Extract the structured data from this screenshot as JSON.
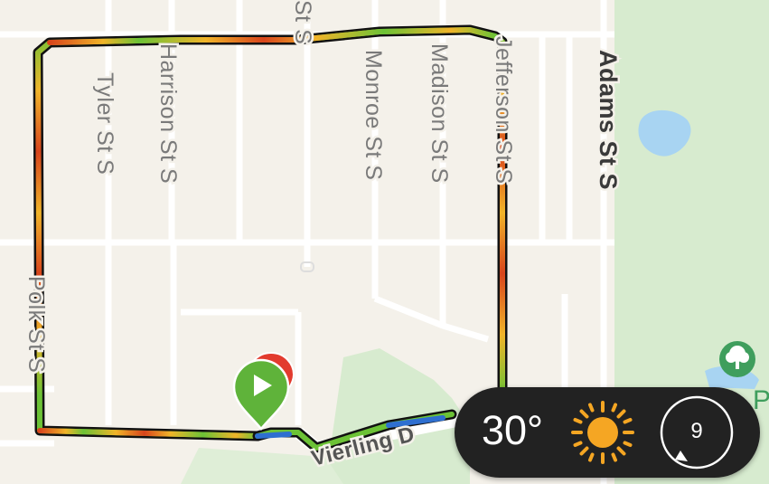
{
  "map": {
    "streets": [
      {
        "id": "tyler",
        "label": "Tyler St S"
      },
      {
        "id": "harrison",
        "label": "Harrison St S"
      },
      {
        "id": "monroe",
        "label": "Monroe St S"
      },
      {
        "id": "madison",
        "label": "Madison St S"
      },
      {
        "id": "jefferson",
        "label": "Jefferson St S"
      },
      {
        "id": "adams",
        "label": "Adams St S"
      },
      {
        "id": "polk",
        "label": "Polk St S"
      },
      {
        "id": "partial",
        "label": "St S"
      },
      {
        "id": "vierling",
        "label": "Vierling D"
      }
    ],
    "park_icon": "park-tree-icon",
    "park_label": "P",
    "markers": {
      "start": "play-icon",
      "end": "red-pin-icon"
    }
  },
  "weather": {
    "temperature": "30°",
    "condition_icon": "sun-icon",
    "wind_value": "9"
  },
  "colors": {
    "route_fast": "#6cc236",
    "route_mid": "#f0b429",
    "route_slow": "#d8451c",
    "start_marker": "#5fb33a",
    "end_marker": "#e23b2e",
    "widget_bg": "#222222",
    "sun": "#f5a623",
    "park": "#3f9e5d"
  }
}
